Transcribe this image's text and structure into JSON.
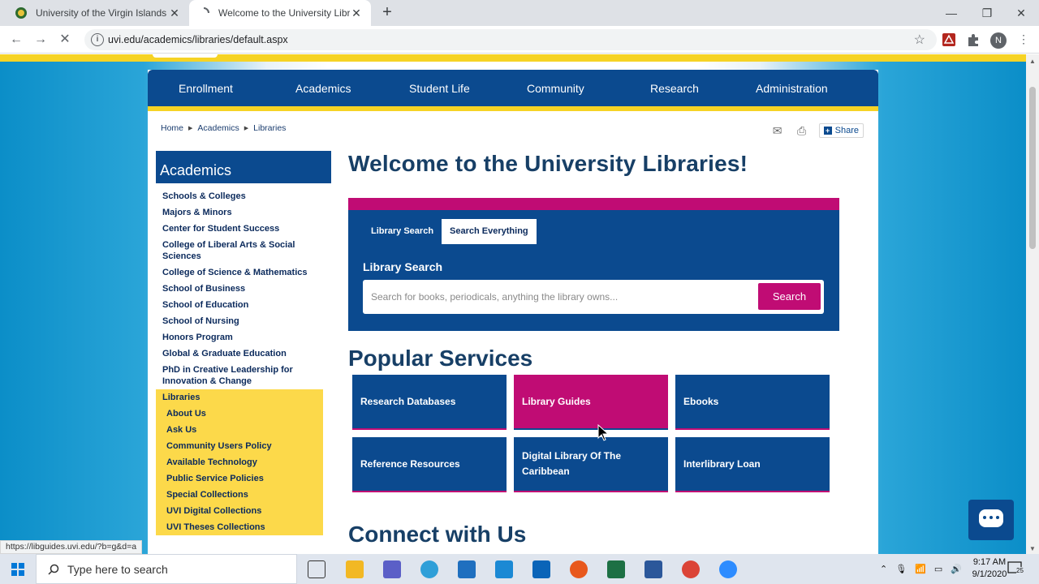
{
  "browser": {
    "tabs": [
      {
        "title": "University of the Virgin Islands",
        "active": false
      },
      {
        "title": "Welcome to the University Librar",
        "active": true
      }
    ],
    "url": "uvi.edu/academics/libraries/default.aspx",
    "profile_initial": "N",
    "status_url": "https://libguides.uvi.edu/?b=g&d=a"
  },
  "nav": {
    "items": [
      "Enrollment",
      "Academics",
      "Student Life",
      "Community",
      "Research",
      "Administration"
    ]
  },
  "breadcrumb": [
    "Home",
    "Academics",
    "Libraries"
  ],
  "share_label": "Share",
  "sidebar": {
    "title": "Academics",
    "items": [
      "Schools & Colleges",
      "Majors & Minors",
      "Center for Student Success",
      "College of Liberal Arts & Social Sciences",
      "College of Science & Mathematics",
      "School of Business",
      "School of Education",
      "School of Nursing",
      "Honors Program",
      "Global & Graduate Education",
      "PhD in Creative Leadership for Innovation & Change"
    ],
    "active": "Libraries",
    "subitems": [
      "About Us",
      "Ask Us",
      "Community Users Policy",
      "Available Technology",
      "Public Service Policies",
      "Special Collections",
      "UVI Digital Collections",
      "UVI Theses Collections"
    ]
  },
  "main": {
    "title": "Welcome to the University Libraries!",
    "search": {
      "tabs": [
        "Library Search",
        "Search Everything"
      ],
      "heading": "Library Search",
      "placeholder": "Search for books, periodicals, anything the library owns...",
      "button": "Search"
    },
    "popular_title": "Popular Services",
    "services": [
      {
        "label": "Research Databases",
        "highlight": false
      },
      {
        "label": "Library Guides",
        "highlight": true
      },
      {
        "label": "Ebooks",
        "highlight": false
      },
      {
        "label": "Reference Resources",
        "highlight": false
      },
      {
        "label": "Digital Library Of The Caribbean",
        "highlight": false
      },
      {
        "label": "Interlibrary Loan",
        "highlight": false
      }
    ],
    "connect_title": "Connect with Us"
  },
  "taskbar": {
    "search_placeholder": "Type here to search",
    "time": "9:17 AM",
    "date": "9/1/2020",
    "notification_count": "25"
  },
  "colors": {
    "navy": "#0b4a8f",
    "magenta": "#c00c74",
    "gold": "#f6d325"
  }
}
